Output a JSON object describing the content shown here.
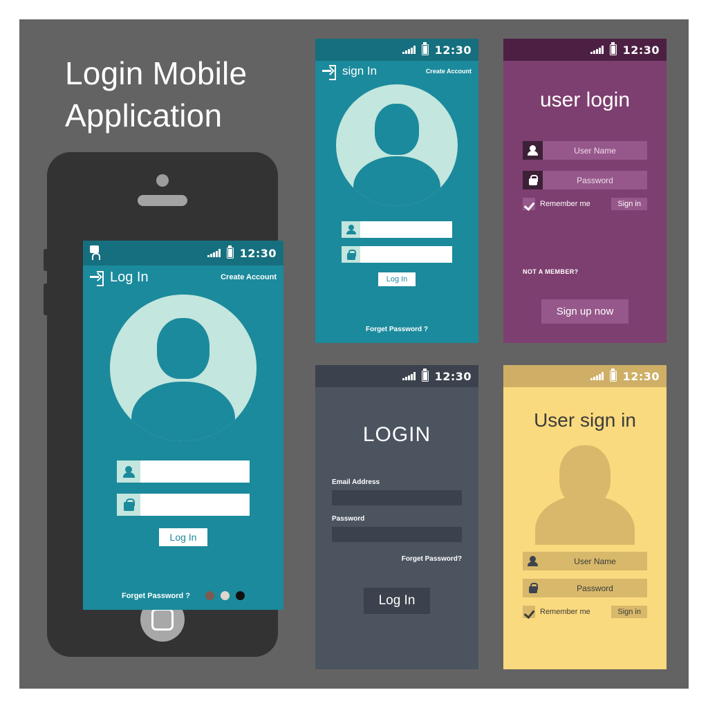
{
  "page": {
    "title_line1": "Login Mobile",
    "title_line2": "Application",
    "background": "#636363"
  },
  "status_bar": {
    "time": "12:30",
    "icons": [
      "signal-icon",
      "battery-icon"
    ],
    "lock_icon": "lock-icon"
  },
  "screens": {
    "phone_main": {
      "name": "teal-phone-login",
      "accent": "#1b8a9c",
      "statusbar_bg": "#166f7e",
      "nav_title": "Log In",
      "nav_action": "Create Account",
      "nav_icon": "login-arrow-icon",
      "avatar_icon": "user-avatar-icon",
      "username_icon": "user-icon",
      "password_icon": "lock-icon",
      "username_value": "",
      "username_placeholder": "",
      "password_value": "",
      "password_placeholder": "",
      "submit_label": "Log In",
      "forgot_label": "Forget Password ?",
      "pager_dots": [
        "#7c5b52",
        "#ded6cc",
        "#111111"
      ]
    },
    "teal_signin": {
      "name": "teal-signin",
      "accent": "#1b8a9c",
      "statusbar_bg": "#166f7e",
      "nav_title": "sign In",
      "nav_action": "Create Account",
      "nav_icon": "login-arrow-icon",
      "avatar_icon": "user-avatar-icon",
      "username_icon": "user-icon",
      "password_icon": "lock-icon",
      "submit_label": "Log In",
      "forgot_label": "Forget Password ?"
    },
    "purple_login": {
      "name": "purple-user-login",
      "accent": "#7d3f6f",
      "statusbar_bg": "#4d2043",
      "heading": "user login",
      "username_icon": "user-icon",
      "username_placeholder": "User Name",
      "password_icon": "lock-icon",
      "password_placeholder": "Password",
      "remember_label": "Remember me",
      "remember_checked": true,
      "signin_label": "Sign in",
      "not_member_label": "NOT A MEMBER?",
      "signup_label": "Sign up now"
    },
    "dark_login": {
      "name": "dark-login",
      "accent": "#4c5460",
      "statusbar_bg": "#3b424d",
      "heading": "LOGIN",
      "email_label": "Email Address",
      "email_value": "",
      "password_label": "Password",
      "password_value": "",
      "forgot_label": "Forget Password?",
      "submit_label": "Log In"
    },
    "yellow_signin": {
      "name": "yellow-user-sign-in",
      "accent": "#fada7e",
      "statusbar_bg": "#cfae66",
      "heading": "User sign in",
      "avatar_icon": "user-avatar-icon",
      "username_icon": "user-icon",
      "username_placeholder": "User Name",
      "password_icon": "lock-icon",
      "password_placeholder": "Password",
      "remember_label": "Remember me",
      "remember_checked": true,
      "signin_label": "Sign in"
    }
  }
}
